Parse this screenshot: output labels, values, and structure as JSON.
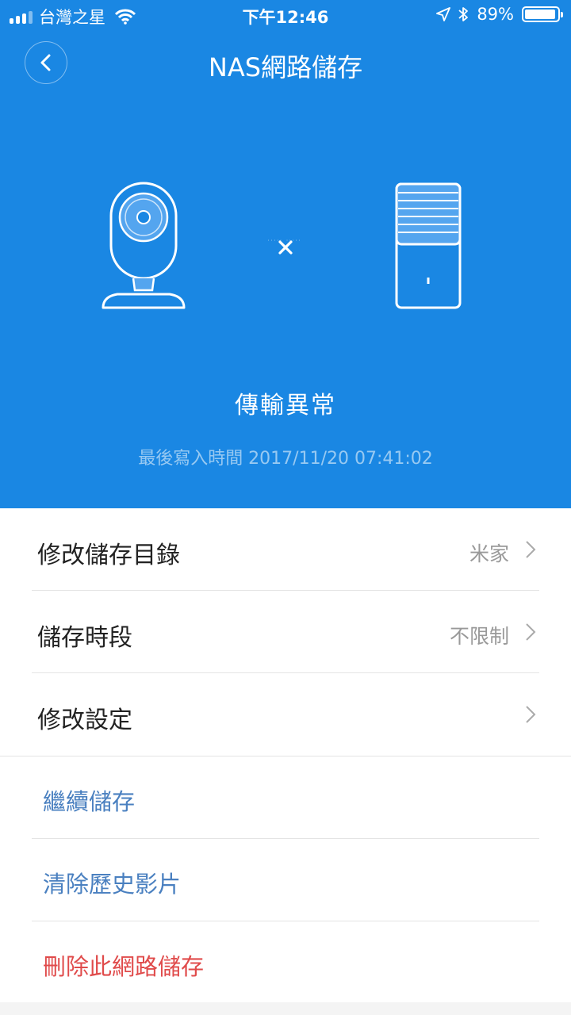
{
  "status_bar": {
    "carrier": "台灣之星",
    "time": "下午12:46",
    "battery": "89%",
    "battery_level": 0.89
  },
  "nav": {
    "title": "NAS網路儲存",
    "back_icon": "chevron-left-icon"
  },
  "hero": {
    "status": "傳輸異常",
    "last_write": "最後寫入時間 2017/11/20 07:41:02",
    "connection_state_icon": "cross-icon",
    "background_color": "#1a87e3"
  },
  "settings": [
    {
      "label": "修改儲存目錄",
      "value": "米家"
    },
    {
      "label": "儲存時段",
      "value": "不限制"
    },
    {
      "label": "修改設定",
      "value": ""
    }
  ],
  "actions": [
    {
      "label": "繼續儲存"
    },
    {
      "label": "清除歷史影片"
    },
    {
      "label": "刪除此網路儲存"
    }
  ],
  "colors": {
    "action_text": "#4a80c0",
    "danger_text": "#e04b4b"
  }
}
